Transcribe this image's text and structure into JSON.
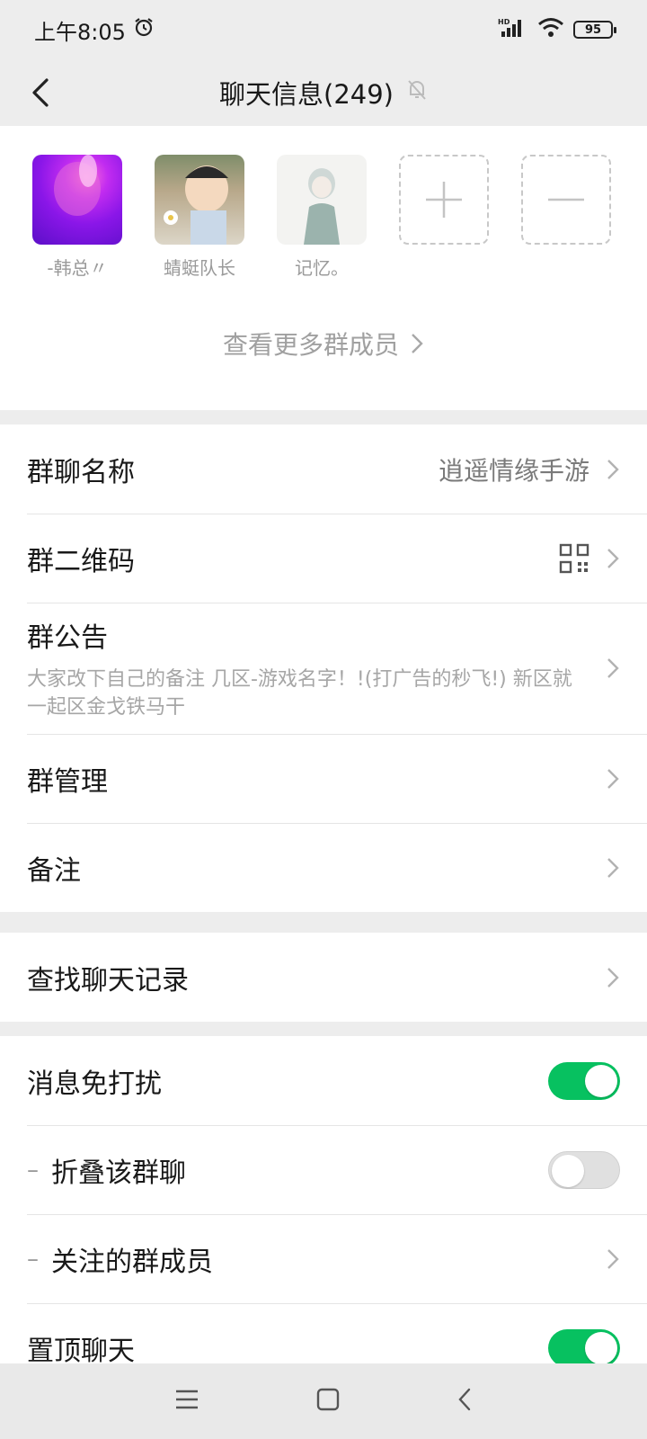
{
  "status_bar": {
    "time": "上午8:05",
    "battery": "95"
  },
  "header": {
    "title": "聊天信息(249)"
  },
  "members": [
    {
      "name": "-韩总〃"
    },
    {
      "name": "蜻蜓队长"
    },
    {
      "name": "记忆。"
    }
  ],
  "view_more": "查看更多群成员",
  "settings": {
    "group_name_label": "群聊名称",
    "group_name_value": "逍遥情缘手游",
    "qr_label": "群二维码",
    "notice_label": "群公告",
    "notice_text": "大家改下自己的备注 几区-游戏名字！!(打广告的秒飞!) 新区就一起区金戈铁马干",
    "manage_label": "群管理",
    "remark_label": "备注",
    "search_label": "查找聊天记录",
    "mute_label": "消息免打扰",
    "mute_on": true,
    "fold_label": "折叠该群聊",
    "fold_on": false,
    "follow_label": "关注的群成员",
    "pin_label": "置顶聊天",
    "pin_on": true
  },
  "colors": {
    "accent_green": "#07c160",
    "background": "#ededed"
  }
}
